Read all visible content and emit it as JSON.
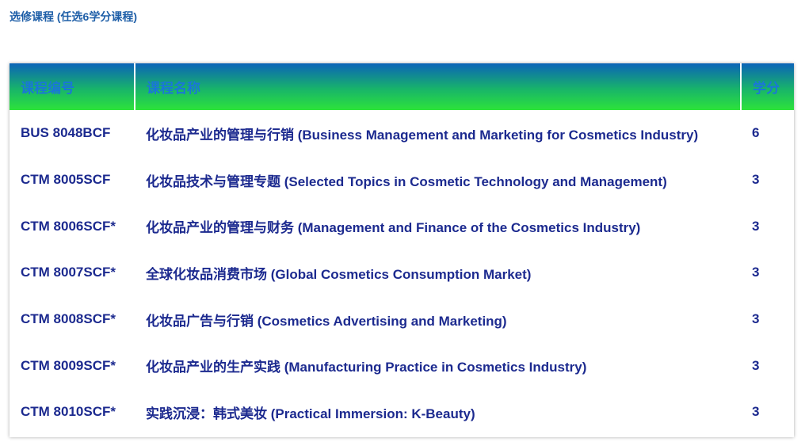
{
  "section_title": "选修课程 (任选6学分课程)",
  "table": {
    "headers": [
      "课程编号",
      "课程名称",
      "学分"
    ],
    "rows": [
      {
        "code": "BUS 8048BCF",
        "name": "化妆品产业的管理与行销 (Business Management and Marketing for Cosmetics Industry)",
        "credits": "6"
      },
      {
        "code": "CTM 8005SCF",
        "name": "化妆品技术与管理专题 (Selected Topics in Cosmetic Technology and Management)",
        "credits": "3"
      },
      {
        "code": "CTM 8006SCF*",
        "name": "化妆品产业的管理与财务 (Management and Finance of the Cosmetics Industry)",
        "credits": "3"
      },
      {
        "code": "CTM 8007SCF*",
        "name": "全球化妆品消费市场 (Global Cosmetics Consumption Market)",
        "credits": "3"
      },
      {
        "code": "CTM 8008SCF*",
        "name": "化妆品广告与行销 (Cosmetics Advertising and Marketing)",
        "credits": "3"
      },
      {
        "code": "CTM 8009SCF*",
        "name": "化妆品产业的生产实践 (Manufacturing Practice in Cosmetics Industry)",
        "credits": "3"
      },
      {
        "code": "CTM 8010SCF*",
        "name": "实践沉浸：韩式美妆 (Practical Immersion: K-Beauty)",
        "credits": "3"
      }
    ]
  },
  "colors": {
    "title": "#1f5fa8",
    "header_gradient_top": "#0b63b8",
    "header_gradient_bottom": "#2de33a",
    "header_text": "#1a76d8",
    "cell_text": "#1c2a8f"
  }
}
